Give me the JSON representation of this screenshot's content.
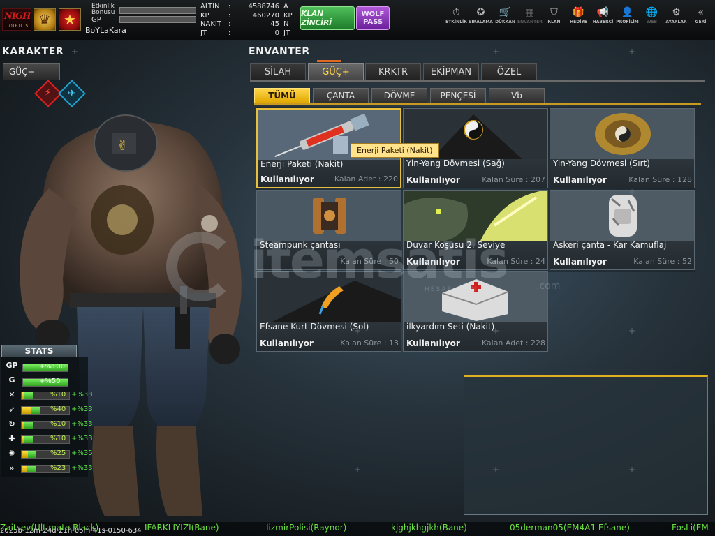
{
  "topbar": {
    "game_logo": "NIGHT OIBILIS",
    "event_bonus_label": "Etkinlik\nBonusu",
    "gp_label": "GP",
    "player_name": "BoYLaKara",
    "currencies": [
      {
        "name": "ALTIN",
        "sep": ":",
        "value": "4588746",
        "unit": "A"
      },
      {
        "name": "KP",
        "sep": ":",
        "value": "460270",
        "unit": "KP"
      },
      {
        "name": "NAKİT",
        "sep": ":",
        "value": "45",
        "unit": "N"
      },
      {
        "name": "JT",
        "sep": ":",
        "value": "0",
        "unit": "JT"
      }
    ],
    "clan_chain_button": "KLAN ZİNCİRİ",
    "wolf_pass_button_1": "WOLF",
    "wolf_pass_button_2": "PASS",
    "menu": [
      {
        "label": "ETKİNLİK",
        "icon": "stopwatch-icon",
        "glyph": "⏱",
        "enabled": true
      },
      {
        "label": "SIRALAMA",
        "icon": "medal-icon",
        "glyph": "✪",
        "enabled": true
      },
      {
        "label": "DÜKKAN",
        "icon": "cart-icon",
        "glyph": "🛒",
        "enabled": true
      },
      {
        "label": "ENVANTER",
        "icon": "inventory-icon",
        "glyph": "▦",
        "enabled": false
      },
      {
        "label": "KLAN",
        "icon": "clan-shield-icon",
        "glyph": "⛉",
        "enabled": true
      },
      {
        "label": "HEDİYE",
        "icon": "gift-icon",
        "glyph": "🎁",
        "enabled": true
      },
      {
        "label": "HABERCİ",
        "icon": "megaphone-icon",
        "glyph": "📢",
        "enabled": true
      },
      {
        "label": "PROFİLİM",
        "icon": "profile-icon",
        "glyph": "👤",
        "enabled": true
      },
      {
        "label": "WEB",
        "icon": "globe-icon",
        "glyph": "🌐",
        "enabled": false
      },
      {
        "label": "AYARLAR",
        "icon": "gear-icon",
        "glyph": "⚙",
        "enabled": true
      },
      {
        "label": "GERİ",
        "icon": "back-chevron-icon",
        "glyph": "«",
        "enabled": true
      }
    ]
  },
  "left": {
    "title": "KARAKTER",
    "tab": "GÜÇ+",
    "stats_title": "STATS",
    "stats": [
      {
        "icon": "gp-icon",
        "glyph": "GP",
        "full": true,
        "text": "+%100"
      },
      {
        "icon": "g-icon",
        "glyph": "G",
        "full": true,
        "text": "+%50"
      },
      {
        "icon": "attack-icon",
        "glyph": "✕",
        "full": false,
        "level": 0.1,
        "value": "%10",
        "bonus": "+%33"
      },
      {
        "icon": "run-icon",
        "glyph": "➶",
        "full": false,
        "level": 0.4,
        "value": "%40",
        "bonus": "+%33"
      },
      {
        "icon": "reload-icon",
        "glyph": "↻",
        "full": false,
        "level": 0.1,
        "value": "%10",
        "bonus": "+%33"
      },
      {
        "icon": "health-icon",
        "glyph": "✚",
        "full": false,
        "level": 0.1,
        "value": "%10",
        "bonus": "+%33"
      },
      {
        "icon": "skill-icon",
        "glyph": "✺",
        "full": false,
        "level": 0.25,
        "value": "%25",
        "bonus": "+%35"
      },
      {
        "icon": "speed-icon",
        "glyph": "»",
        "full": false,
        "level": 0.23,
        "value": "%23",
        "bonus": "+%33"
      }
    ]
  },
  "inventory": {
    "title": "ENVANTER",
    "tabs": [
      "SİLAH",
      "GÜÇ+",
      "KRKTR",
      "EKİPMAN",
      "ÖZEL"
    ],
    "active_tab": 1,
    "subtabs": [
      "TÜMÜ",
      "ÇANTA",
      "DÖVME",
      "PENÇESİ",
      "Vb"
    ],
    "active_subtab": 0,
    "items": [
      {
        "name": "Enerji Paketi (Nakit)",
        "status": "Kullanılıyor",
        "remain": "Kalan Adet : 220",
        "art": "syringe"
      },
      {
        "name": "Yin-Yang Dövmesi (Sağ)",
        "status": "Kullanılıyor",
        "remain": "Kalan Süre : 207",
        "art": "yinyang"
      },
      {
        "name": "Yin-Yang Dövmesi (Sırt)",
        "status": "Kullanılıyor",
        "remain": "Kalan Süre : 128",
        "art": "dragon"
      },
      {
        "name": "Steampunk çantası",
        "status": "",
        "remain": "Kalan Süre : 50",
        "art": "steampunk"
      },
      {
        "name": "Duvar Koşusu 2. Seviye",
        "status": "Kullanılıyor",
        "remain": "Kalan Süre : 24",
        "art": "wolf"
      },
      {
        "name": "Askeri çanta - Kar Kamuflaj",
        "status": "Kullanılıyor",
        "remain": "Kalan Süre : 52",
        "art": "backpack"
      },
      {
        "name": "Efsane Kurt Dövmesi (Sol)",
        "status": "Kullanılıyor",
        "remain": "Kalan Süre : 13",
        "art": "tattoo"
      },
      {
        "name": "ilkyardım Seti (Nakit)",
        "status": "Kullanılıyor",
        "remain": "Kalan Adet : 228",
        "art": "medkit"
      }
    ],
    "tooltip": "Enerji Paketi (Nakit)"
  },
  "watermark": {
    "text": "itemsatis",
    "domain": ".com",
    "sub": "HESAP · PİN"
  },
  "ticker": {
    "date": "2025b-12m-24d-21h-05m-41s-0150-634",
    "messages": [
      "Zaitsev(Ultimate Black)",
      "IFARKLIYIZI(Bane)",
      "IizmirPolisi(Raynor)",
      "kjghjkhgjkh(Bane)",
      "05derman05(EM4A1 Efsane)",
      "FosLi(EM"
    ]
  },
  "colors": {
    "accent": "#ffd24a",
    "ticker_green": "#6ae040",
    "bonus_green": "#59e04a"
  }
}
